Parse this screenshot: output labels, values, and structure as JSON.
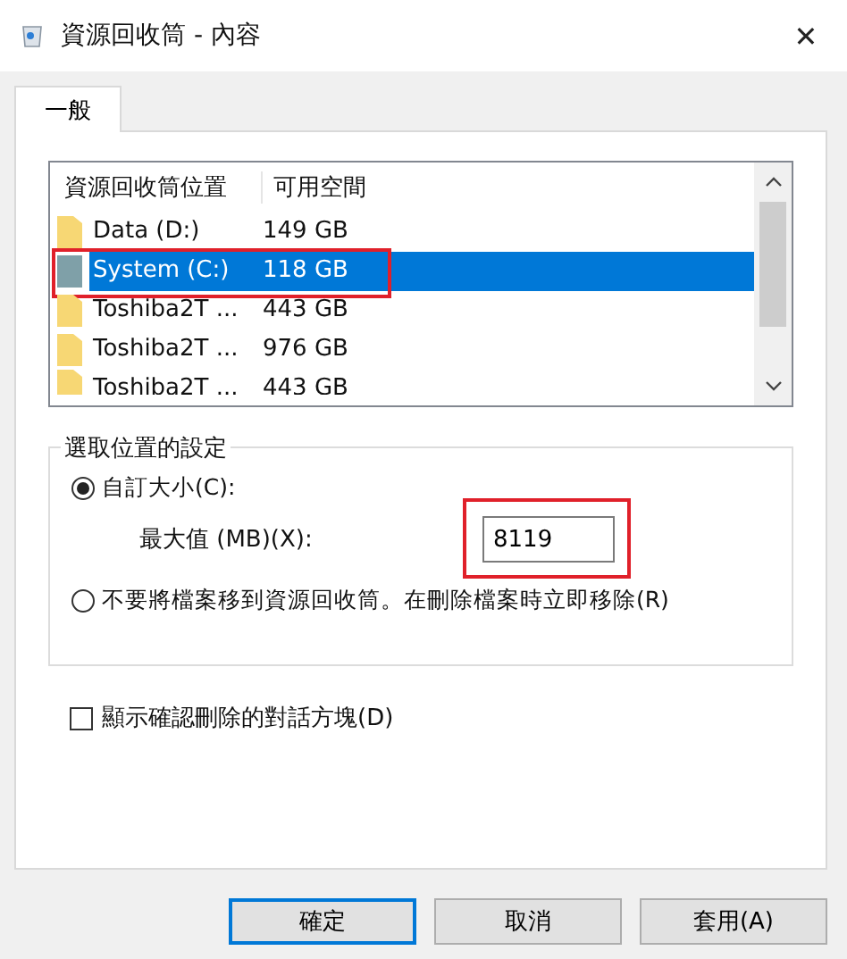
{
  "window": {
    "title": "資源回收筒 - 內容",
    "close": "✕"
  },
  "tabs": [
    {
      "label": "一般",
      "selected": true
    }
  ],
  "locations": {
    "columns": [
      "資源回收筒位置",
      "可用空間"
    ],
    "rows": [
      {
        "name": "Data (D:)",
        "free": "149 GB",
        "kind": "folder",
        "selected": false,
        "highlighted": false
      },
      {
        "name": "System (C:)",
        "free": "118 GB",
        "kind": "system",
        "selected": true,
        "highlighted": true
      },
      {
        "name": "Toshiba2T ...",
        "free": "443 GB",
        "kind": "folder",
        "selected": false,
        "highlighted": false
      },
      {
        "name": "Toshiba2T ...",
        "free": "976 GB",
        "kind": "folder",
        "selected": false,
        "highlighted": false
      },
      {
        "name": "Toshiba2T ...",
        "free": "443 GB",
        "kind": "folder",
        "selected": false,
        "highlighted": false
      }
    ]
  },
  "settings": {
    "legend": "選取位置的設定",
    "custom": {
      "label": "自訂大小(C):",
      "selected": true
    },
    "max_label": "最大值 (MB)(X):",
    "max_value": {
      "value": "8119",
      "highlighted": true
    },
    "immediate": {
      "label": "不要將檔案移到資源回收筒。在刪除檔案時立即移除(R)",
      "selected": false
    }
  },
  "confirm": {
    "label": "顯示確認刪除的對話方塊(D)",
    "checked": false
  },
  "buttons": [
    {
      "label": "確定",
      "default": true
    },
    {
      "label": "取消",
      "default": false
    },
    {
      "label": "套用(A)",
      "default": false
    }
  ]
}
